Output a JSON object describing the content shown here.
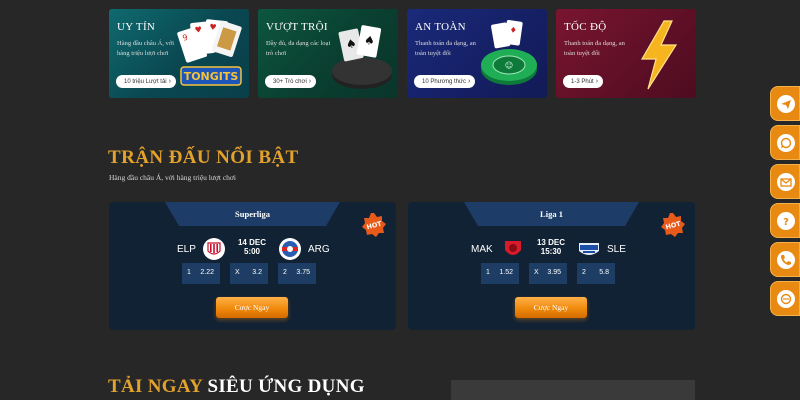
{
  "features": [
    {
      "title": "UY TÍN",
      "desc": "Hàng đầu châu Á, với hàng triệu lượt chơi",
      "pill": "10 triệu Lượt tải",
      "art": "playing-cards-tongits",
      "theme": "#0f6a6f"
    },
    {
      "title": "VƯỢT TRỘI",
      "desc": "Đầy đủ, đa dạng các loại trò chơi",
      "pill": "30+ Trò chơi",
      "art": "card-table",
      "theme": "#0d5640"
    },
    {
      "title": "AN TOÀN",
      "desc": "Thanh toán đa dạng, an toàn tuyệt đối",
      "pill": "10 Phương thức",
      "art": "poker-chip",
      "theme": "#1a2a7a"
    },
    {
      "title": "TỐC ĐỘ",
      "desc": "Thanh toán đa dạng, an toàn tuyệt đối",
      "pill": "1-3 Phút",
      "art": "lightning",
      "theme": "#7a1530"
    }
  ],
  "featured": {
    "title": "TRẬN ĐẤU NỔI BẬT",
    "subtitle": "Hàng đầu châu Á, với hàng triệu lượt chơi"
  },
  "matches": [
    {
      "league": "Superliga",
      "badge": "HOT",
      "home": "ELP",
      "away": "ARG",
      "date": "14 DEC",
      "time": "5:00",
      "odds": [
        {
          "k": "1",
          "v": "2.22"
        },
        {
          "k": "X",
          "v": "3.2"
        },
        {
          "k": "2",
          "v": "3.75"
        }
      ],
      "button": "Cược Ngay"
    },
    {
      "league": "Liga 1",
      "badge": "HOT",
      "home": "MAK",
      "away": "SLE",
      "date": "13 DEC",
      "time": "15:30",
      "odds": [
        {
          "k": "1",
          "v": "1.52"
        },
        {
          "k": "X",
          "v": "3.95"
        },
        {
          "k": "2",
          "v": "5.8"
        }
      ],
      "button": "Cược Ngay"
    }
  ],
  "download": {
    "highlight": "TẢI NGAY",
    "rest": " SIÊU ỨNG DỤNG"
  },
  "sidebar": [
    {
      "icon": "telegram-icon"
    },
    {
      "icon": "whatsapp-icon"
    },
    {
      "icon": "email-icon"
    },
    {
      "icon": "help-icon"
    },
    {
      "icon": "phone-icon"
    },
    {
      "icon": "livechat-icon"
    }
  ],
  "colors": {
    "accent": "#e3a22c",
    "background": "#272727",
    "match_card": "#112234",
    "button": "#f08a0c"
  }
}
